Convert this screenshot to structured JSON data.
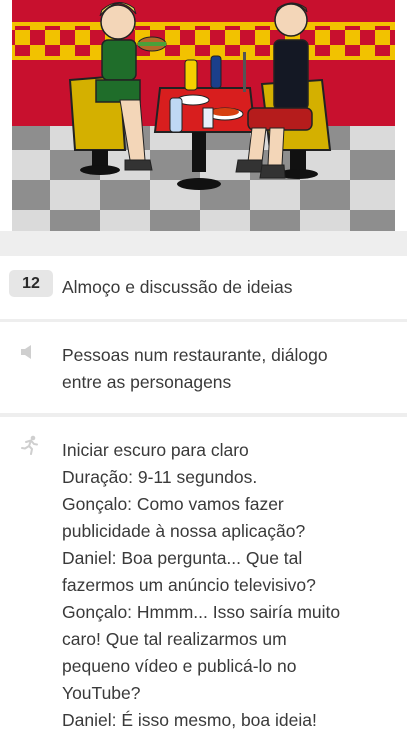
{
  "storyboard": {
    "scene_image": {
      "description": "Two cartoon characters eating at a restaurant table"
    },
    "cell": {
      "number": "12",
      "title": "Almoço e discussão de ideias",
      "sound_icon": "speaker-icon",
      "sound_lines": [
        "Pessoas num restaurante, diálogo",
        "entre as personagens"
      ],
      "action_icon": "running-person-icon",
      "action_lines": [
        "Iniciar escuro para claro",
        "Duração: 9-11 segundos.",
        "Gonçalo: Como vamos fazer",
        "publicidade à nossa aplicação?",
        "Daniel: Boa pergunta... Que tal",
        "fazermos um anúncio televisivo?",
        "Gonçalo: Hmmm... Isso sairía muito",
        "caro! Que tal realizarmos um",
        "pequeno vídeo e publicá-lo no",
        "YouTube?",
        "Daniel: É isso mesmo, boa ideia!"
      ]
    },
    "colors": {
      "wall_red": "#c8102e",
      "wall_yellow": "#f2c200",
      "booth_yellow": "#d4b000",
      "floor_dark": "#8e8e8e",
      "floor_light": "#dadada",
      "table_red": "#d81e1e"
    }
  }
}
